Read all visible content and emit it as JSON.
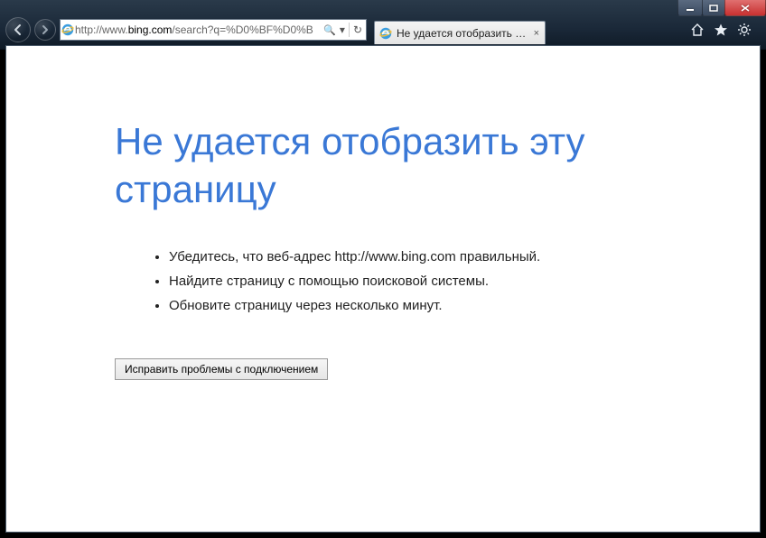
{
  "window": {
    "caption_minimize": "—",
    "caption_maximize": "❐",
    "caption_close": "✕"
  },
  "nav": {
    "back_icon": "←",
    "forward_icon": "→"
  },
  "address": {
    "url_prefix": "http://www.",
    "url_host": "bing.com",
    "url_path": "/search?q=%D0%BF%D0%B",
    "search_glyph": "🔍",
    "dropdown_glyph": "▾",
    "refresh_glyph": "↻"
  },
  "tab": {
    "title": "Не удается отобразить эту...",
    "close_glyph": "×"
  },
  "toolbar": {
    "home_icon": "home",
    "favorites_icon": "star",
    "tools_icon": "gear"
  },
  "page": {
    "heading": "Не удается отобразить эту страницу",
    "bullets": [
      "Убедитесь, что веб-адрес http://www.bing.com правильный.",
      "Найдите страницу с помощью поисковой системы.",
      "Обновите страницу через несколько минут."
    ],
    "fix_button": "Исправить проблемы с подключением"
  }
}
